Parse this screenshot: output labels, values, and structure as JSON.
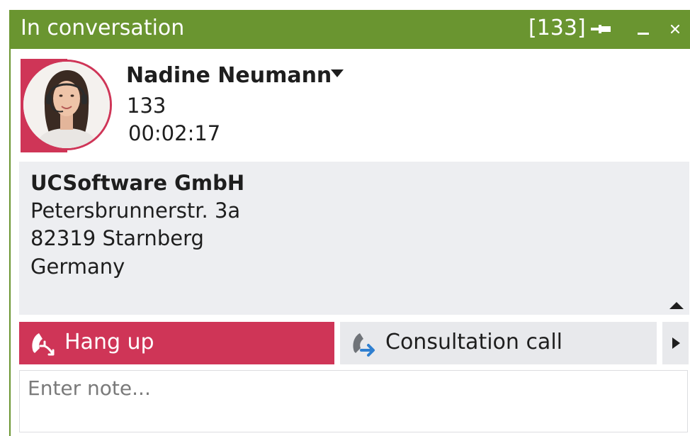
{
  "window": {
    "title": "In conversation",
    "extension": "[133]",
    "accent_color": "#6a9530",
    "icons": {
      "pin": "pin-icon",
      "minimize": "minimize-icon",
      "close": "close-icon"
    }
  },
  "contact": {
    "name": "Nadine Neumann",
    "number": "133",
    "duration": "00:02:17",
    "avatar": "avatar-photo",
    "accent_color": "#cf3557"
  },
  "address": {
    "company": "UCSoftware GmbH",
    "street": "Petersbrunnerstr. 3a",
    "city": "82319 Starnberg",
    "country": "Germany"
  },
  "actions": {
    "hangup_label": "Hang up",
    "hangup_icon": "hangup-phone-icon",
    "consult_label": "Consultation call",
    "consult_icon": "transfer-phone-icon",
    "more_icon": "chevron-right-icon"
  },
  "note": {
    "placeholder": "Enter note..."
  }
}
